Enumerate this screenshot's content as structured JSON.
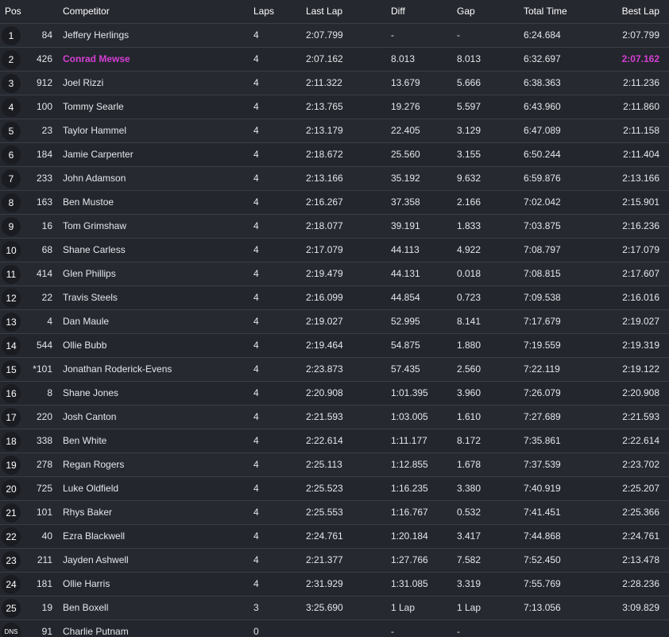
{
  "headers": {
    "pos": "Pos",
    "competitor": "Competitor",
    "laps": "Laps",
    "last_lap": "Last Lap",
    "diff": "Diff",
    "gap": "Gap",
    "total_time": "Total Time",
    "best_lap": "Best Lap"
  },
  "highlight_color": "#d63fd6",
  "rows": [
    {
      "pos": "1",
      "num": "84",
      "name": "Jeffery Herlings",
      "laps": "4",
      "last": "2:07.799",
      "diff": "-",
      "gap": "-",
      "total": "6:24.684",
      "best": "2:07.799"
    },
    {
      "pos": "2",
      "num": "426",
      "name": "Conrad Mewse",
      "laps": "4",
      "last": "2:07.162",
      "diff": "8.013",
      "gap": "8.013",
      "total": "6:32.697",
      "best": "2:07.162",
      "highlight": true
    },
    {
      "pos": "3",
      "num": "912",
      "name": "Joel Rizzi",
      "laps": "4",
      "last": "2:11.322",
      "diff": "13.679",
      "gap": "5.666",
      "total": "6:38.363",
      "best": "2:11.236"
    },
    {
      "pos": "4",
      "num": "100",
      "name": "Tommy Searle",
      "laps": "4",
      "last": "2:13.765",
      "diff": "19.276",
      "gap": "5.597",
      "total": "6:43.960",
      "best": "2:11.860"
    },
    {
      "pos": "5",
      "num": "23",
      "name": "Taylor Hammel",
      "laps": "4",
      "last": "2:13.179",
      "diff": "22.405",
      "gap": "3.129",
      "total": "6:47.089",
      "best": "2:11.158"
    },
    {
      "pos": "6",
      "num": "184",
      "name": "Jamie Carpenter",
      "laps": "4",
      "last": "2:18.672",
      "diff": "25.560",
      "gap": "3.155",
      "total": "6:50.244",
      "best": "2:11.404"
    },
    {
      "pos": "7",
      "num": "233",
      "name": "John Adamson",
      "laps": "4",
      "last": "2:13.166",
      "diff": "35.192",
      "gap": "9.632",
      "total": "6:59.876",
      "best": "2:13.166"
    },
    {
      "pos": "8",
      "num": "163",
      "name": "Ben Mustoe",
      "laps": "4",
      "last": "2:16.267",
      "diff": "37.358",
      "gap": "2.166",
      "total": "7:02.042",
      "best": "2:15.901"
    },
    {
      "pos": "9",
      "num": "16",
      "name": "Tom Grimshaw",
      "laps": "4",
      "last": "2:18.077",
      "diff": "39.191",
      "gap": "1.833",
      "total": "7:03.875",
      "best": "2:16.236"
    },
    {
      "pos": "10",
      "num": "68",
      "name": "Shane Carless",
      "laps": "4",
      "last": "2:17.079",
      "diff": "44.113",
      "gap": "4.922",
      "total": "7:08.797",
      "best": "2:17.079"
    },
    {
      "pos": "11",
      "num": "414",
      "name": "Glen Phillips",
      "laps": "4",
      "last": "2:19.479",
      "diff": "44.131",
      "gap": "0.018",
      "total": "7:08.815",
      "best": "2:17.607"
    },
    {
      "pos": "12",
      "num": "22",
      "name": "Travis Steels",
      "laps": "4",
      "last": "2:16.099",
      "diff": "44.854",
      "gap": "0.723",
      "total": "7:09.538",
      "best": "2:16.016"
    },
    {
      "pos": "13",
      "num": "4",
      "name": "Dan Maule",
      "laps": "4",
      "last": "2:19.027",
      "diff": "52.995",
      "gap": "8.141",
      "total": "7:17.679",
      "best": "2:19.027"
    },
    {
      "pos": "14",
      "num": "544",
      "name": "Ollie Bubb",
      "laps": "4",
      "last": "2:19.464",
      "diff": "54.875",
      "gap": "1.880",
      "total": "7:19.559",
      "best": "2:19.319"
    },
    {
      "pos": "15",
      "num": "*101",
      "name": "Jonathan Roderick-Evens",
      "laps": "4",
      "last": "2:23.873",
      "diff": "57.435",
      "gap": "2.560",
      "total": "7:22.119",
      "best": "2:19.122"
    },
    {
      "pos": "16",
      "num": "8",
      "name": "Shane Jones",
      "laps": "4",
      "last": "2:20.908",
      "diff": "1:01.395",
      "gap": "3.960",
      "total": "7:26.079",
      "best": "2:20.908"
    },
    {
      "pos": "17",
      "num": "220",
      "name": "Josh Canton",
      "laps": "4",
      "last": "2:21.593",
      "diff": "1:03.005",
      "gap": "1.610",
      "total": "7:27.689",
      "best": "2:21.593"
    },
    {
      "pos": "18",
      "num": "338",
      "name": "Ben White",
      "laps": "4",
      "last": "2:22.614",
      "diff": "1:11.177",
      "gap": "8.172",
      "total": "7:35.861",
      "best": "2:22.614"
    },
    {
      "pos": "19",
      "num": "278",
      "name": "Regan Rogers",
      "laps": "4",
      "last": "2:25.113",
      "diff": "1:12.855",
      "gap": "1.678",
      "total": "7:37.539",
      "best": "2:23.702"
    },
    {
      "pos": "20",
      "num": "725",
      "name": "Luke Oldfield",
      "laps": "4",
      "last": "2:25.523",
      "diff": "1:16.235",
      "gap": "3.380",
      "total": "7:40.919",
      "best": "2:25.207"
    },
    {
      "pos": "21",
      "num": "101",
      "name": "Rhys Baker",
      "laps": "4",
      "last": "2:25.553",
      "diff": "1:16.767",
      "gap": "0.532",
      "total": "7:41.451",
      "best": "2:25.366"
    },
    {
      "pos": "22",
      "num": "40",
      "name": "Ezra Blackwell",
      "laps": "4",
      "last": "2:24.761",
      "diff": "1:20.184",
      "gap": "3.417",
      "total": "7:44.868",
      "best": "2:24.761"
    },
    {
      "pos": "23",
      "num": "211",
      "name": "Jayden Ashwell",
      "laps": "4",
      "last": "2:21.377",
      "diff": "1:27.766",
      "gap": "7.582",
      "total": "7:52.450",
      "best": "2:13.478"
    },
    {
      "pos": "24",
      "num": "181",
      "name": "Ollie Harris",
      "laps": "4",
      "last": "2:31.929",
      "diff": "1:31.085",
      "gap": "3.319",
      "total": "7:55.769",
      "best": "2:28.236"
    },
    {
      "pos": "25",
      "num": "19",
      "name": "Ben Boxell",
      "laps": "3",
      "last": "3:25.690",
      "diff": "1 Lap",
      "gap": "1 Lap",
      "total": "7:13.056",
      "best": "3:09.829"
    },
    {
      "pos": "DNS",
      "num": "91",
      "name": "Charlie Putnam",
      "laps": "0",
      "last": "",
      "diff": "-",
      "gap": "-",
      "total": "",
      "best": ""
    }
  ]
}
